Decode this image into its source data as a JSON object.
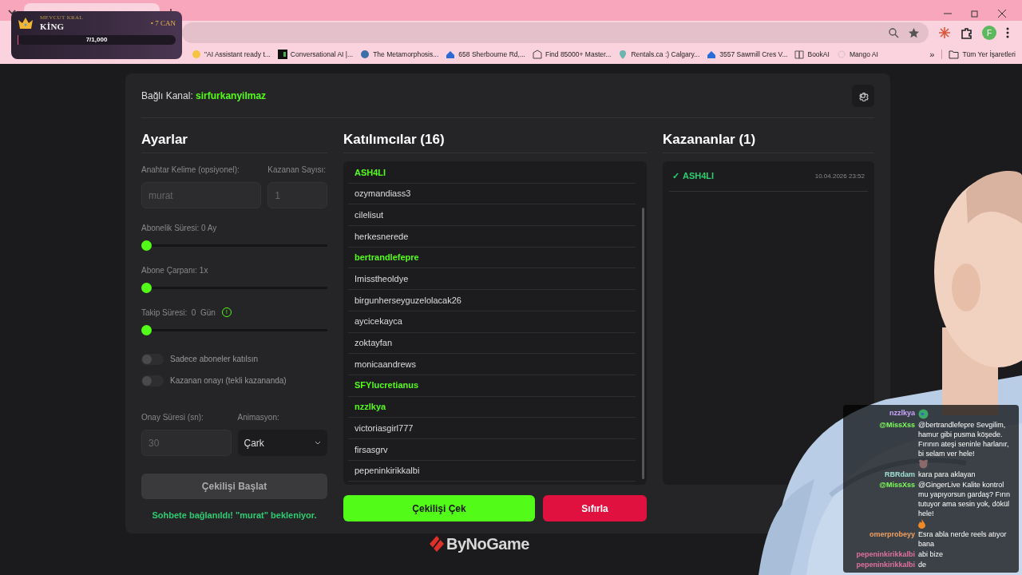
{
  "browser": {
    "bookmarks": [
      {
        "label": "\"AI Assistant ready t..."
      },
      {
        "label": "Conversational AI |..."
      },
      {
        "label": "The Metamorphosis..."
      },
      {
        "label": "658 Sherbourne Rd,..."
      },
      {
        "label": "Find 85000+ Master..."
      },
      {
        "label": "Rentals.ca :) Calgary..."
      },
      {
        "label": "3557 Sawmill Cres V..."
      },
      {
        "label": "BookAI"
      },
      {
        "label": "Mango AI"
      }
    ],
    "more_bookmarks": "»",
    "all_bookmarks": "Tüm Yer İşaretleri",
    "profile": "F"
  },
  "king_overlay": {
    "caption": "MEVCUT KRAL",
    "name": "KİNG",
    "lives": "• 7 CAN",
    "progress": "7/1,000",
    "level": 0.007
  },
  "app": {
    "channel_label": "Bağlı Kanal:",
    "channel": "sirfurkanyilmaz",
    "settings": {
      "title": "Ayarlar",
      "keyword_label": "Anahtar Kelime (opsiyonel):",
      "keyword_placeholder": "murat",
      "winners_label": "Kazanan Sayısı:",
      "winners_placeholder": "1",
      "sliders": [
        {
          "label": "Abonelik Süresi: 0 Ay",
          "level": 0
        },
        {
          "label": "Abone Çarpanı: 1x",
          "level": 0
        },
        {
          "label": "Takip Süresi:  0  Gün",
          "level": 0,
          "info_icon": "!"
        }
      ],
      "toggles": [
        {
          "label": "Sadece aboneler katılsın",
          "on": false
        },
        {
          "label": "Kazanan onayı (tekli kazananda)",
          "on": false
        }
      ],
      "confirm_label": "Onay Süresi (sn):",
      "confirm_placeholder": "30",
      "animation_label": "Animasyon:",
      "animation_value": "Çark",
      "start_button": "Çekilişi Başlat",
      "status": "Sohbete bağlanıldı! \"murat\" bekleniyor."
    },
    "participants": {
      "title": "Katılımcılar (16)",
      "items": [
        {
          "name": "ASH4LI",
          "highlighted": true
        },
        {
          "name": "ozymandiass3",
          "highlighted": false
        },
        {
          "name": "cilelisut",
          "highlighted": false
        },
        {
          "name": "herkesnerede",
          "highlighted": false
        },
        {
          "name": "bertrandlefepre",
          "highlighted": true
        },
        {
          "name": "Imisstheoldye",
          "highlighted": false
        },
        {
          "name": "birgunherseyguzelolacak26",
          "highlighted": false
        },
        {
          "name": "aycicekayca",
          "highlighted": false
        },
        {
          "name": "zoktayfan",
          "highlighted": false
        },
        {
          "name": "monicaandrews",
          "highlighted": false
        },
        {
          "name": "SFYlucretianus",
          "highlighted": true
        },
        {
          "name": "nzzlkya",
          "highlighted": true
        },
        {
          "name": "victoriasgirl777",
          "highlighted": false
        },
        {
          "name": "firsasgrv",
          "highlighted": false
        },
        {
          "name": "pepeninkirikkalbi",
          "highlighted": false
        }
      ],
      "draw_button": "Çekilişi Çek",
      "reset_button": "Sıfırla"
    },
    "winners": {
      "title": "Kazananlar (1)",
      "items": [
        {
          "mark": "✓",
          "name": "ASH4LI",
          "time": "10.04.2026 23:52"
        }
      ]
    }
  },
  "logo": "ByNoGame",
  "chat": [
    {
      "kind": "globe",
      "user": "nzzlkya",
      "color": "#c9a6ff"
    },
    {
      "kind": "face",
      "user": "@MissXss",
      "color": "#7dff5a",
      "text": "@bertrandlefepre Sevgilim, hamur gibi pusma köşede. Fırının ateşi seninle harlanır, bi selam ver hele!"
    },
    {
      "kind": "plain",
      "user": "RBRdam",
      "color": "#9fe0d0",
      "text": "kara para aklayan"
    },
    {
      "kind": "fire",
      "user": "@MissXss",
      "color": "#7dff5a",
      "text": "@GingerLive Kalite kontrol mu yapıyorsun gardaş? Fırın tutuyor ama sesin yok, dökül hele!"
    },
    {
      "kind": "plain",
      "user": "omerprobeyy",
      "color": "#f0a060",
      "text": "Esra abla nerde reels atıyor bana"
    },
    {
      "kind": "plain",
      "user": "pepeninkirikkalbi",
      "color": "#e070a0",
      "text": "abi bize"
    },
    {
      "kind": "plain",
      "user": "pepeninkirikkalbi",
      "color": "#e070a0",
      "text": "de"
    }
  ]
}
